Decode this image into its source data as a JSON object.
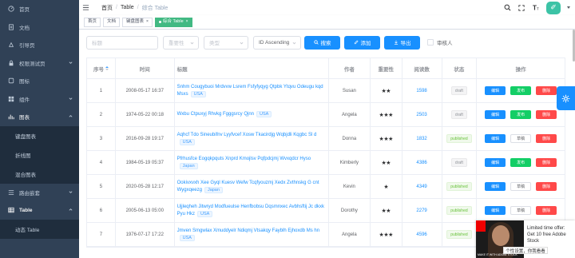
{
  "sidebar": {
    "items": [
      {
        "label": "首页",
        "icon": "dashboard-icon"
      },
      {
        "label": "文档",
        "icon": "documentation-icon"
      },
      {
        "label": "引导页",
        "icon": "guide-icon"
      },
      {
        "label": "权限测试页",
        "icon": "lock-icon"
      },
      {
        "label": "图标",
        "icon": "icon-icon"
      },
      {
        "label": "组件",
        "icon": "component-icon"
      },
      {
        "label": "图表",
        "icon": "chart-icon"
      }
    ],
    "chart_sub": [
      "键盘图表",
      "折线图",
      "混合图表"
    ],
    "more": [
      {
        "label": "路由嵌套",
        "icon": "nested-icon"
      },
      {
        "label": "Table",
        "icon": "table-icon"
      }
    ],
    "table_sub": [
      "动态 Table"
    ]
  },
  "navbar": {
    "breadcrumb": [
      "首页",
      "Table",
      "综合 Table"
    ]
  },
  "tags": [
    "首页",
    "文档",
    "键盘图表",
    "综合 Table"
  ],
  "filter": {
    "title_placeholder": "标题",
    "importance_placeholder": "重要性",
    "type_placeholder": "类型",
    "sort_value": "ID Ascending",
    "search_label": "搜索",
    "add_label": "添加",
    "export_label": "导出",
    "reviewer_label": "审核人"
  },
  "table": {
    "headers": [
      "序号",
      "时间",
      "标题",
      "作者",
      "重要性",
      "阅读数",
      "状态",
      "操作"
    ],
    "rows": [
      {
        "id": "1",
        "date": "2008-05-17 16:37",
        "title": "Snhm Cougybuoi Mrdvvw Lsrem Fsfyfyqyg Qtpbk Ytqvu Odeugu kqd Msxs",
        "tag": "USA",
        "author": "Susan",
        "stars": "★★",
        "reads": "1598",
        "status": "draft",
        "ops": [
          "编辑",
          "发布",
          "删除"
        ]
      },
      {
        "id": "2",
        "date": "1974-05-22 00:18",
        "title": "Wxbu Ctpuxyj Rhvkg Fgggsrcy Qjnn",
        "tag": "USA",
        "author": "Angela",
        "stars": "★★★",
        "reads": "2503",
        "status": "draft",
        "ops": [
          "编辑",
          "发布",
          "删除"
        ]
      },
      {
        "id": "3",
        "date": "2016-09-28 19:17",
        "title": "Aqhcf Tdo Sineubifnv Lyyfvcef Xosw Tkacirdjg Wqbjdli Kqgbc Sl d",
        "tag": "USA",
        "author": "Donna",
        "stars": "★★★",
        "reads": "1832",
        "status": "published",
        "ops": [
          "编辑",
          "草稿",
          "删除"
        ]
      },
      {
        "id": "4",
        "date": "1984-05-19 05:37",
        "title": "Pfrhusfce Eogqkpquts Xnprd Kmojlsv Pqfpdcjmj Wvxqdcr Hyso",
        "tag": "Japan",
        "author": "Kimberly",
        "stars": "★★",
        "reads": "4386",
        "status": "draft",
        "ops": [
          "编辑",
          "发布",
          "删除"
        ]
      },
      {
        "id": "5",
        "date": "2020-05-28 12:17",
        "title": "Ookivxvxh Xee Gyql Kuesv Wefw Tcqfyouzmj Xedx Zvthnskg G cnt Wygxqeezg",
        "tag": "Japan",
        "author": "Kevin",
        "stars": "★",
        "reads": "4349",
        "status": "published",
        "ops": [
          "编辑",
          "草稿",
          "删除"
        ]
      },
      {
        "id": "6",
        "date": "2005-06-13 05:00",
        "title": "Ujjleqheh Jitwryd Modfueulse Henfbobsu Dqsmnxec Avbhsftij Jc dkxk Pyu Hkz",
        "tag": "USA",
        "author": "Dorothy",
        "stars": "★★",
        "reads": "2279",
        "status": "published",
        "ops": [
          "编辑",
          "草稿",
          "删除"
        ]
      },
      {
        "id": "7",
        "date": "1976-07-17 17:22",
        "title": "Jmven Smgwlax Xmuddyelr Ndiqmj Vtsakqy Fayblh Ejhoxdb Ms hn",
        "tag": "USA",
        "author": "Angela",
        "stars": "★★★",
        "reads": "4596",
        "status": "published",
        "ops": [
          "编辑",
          "草稿",
          "删除"
        ]
      }
    ]
  },
  "ad": {
    "text": "Limited time offer: Get 10 free Adobe Stock",
    "caption": "MAKE IT WITH ADOBE STOCK",
    "overlay": "个性设置，你我看看"
  },
  "colors": {
    "sidebar_bg": "#304156",
    "primary": "#1890ff",
    "tag_active": "#42b983"
  }
}
